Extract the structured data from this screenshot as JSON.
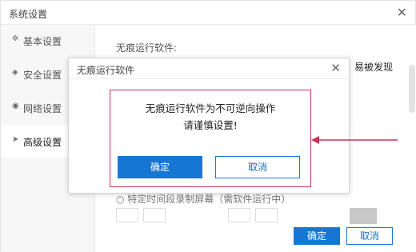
{
  "window": {
    "title": "系统设置",
    "close_glyph": "✕"
  },
  "sidebar": {
    "items": [
      {
        "label": "基本设置",
        "icon": "gear-icon",
        "glyph": "✲"
      },
      {
        "label": "安全设置",
        "icon": "shield-icon",
        "glyph": "◈"
      },
      {
        "label": "网络设置",
        "icon": "network-icon",
        "glyph": "◉"
      },
      {
        "label": "高级设置",
        "icon": "cursor-icon",
        "glyph": "➤"
      }
    ],
    "active_index": 3
  },
  "main": {
    "section_label": "无痕运行软件:",
    "cut_text": "易被发现",
    "radio_label": "○ 特定时间段录制屏幕（需软件运行中）",
    "ok_label": "确定",
    "cancel_label": "取消"
  },
  "dialog": {
    "title": "无痕运行软件",
    "close_glyph": "✕",
    "message_line1": "无痕运行软件为不可逆向操作",
    "message_line2": "请谨慎设置!",
    "ok_label": "确定",
    "cancel_label": "取消"
  },
  "colors": {
    "accent": "#1677d2",
    "highlight": "#c7325c"
  }
}
